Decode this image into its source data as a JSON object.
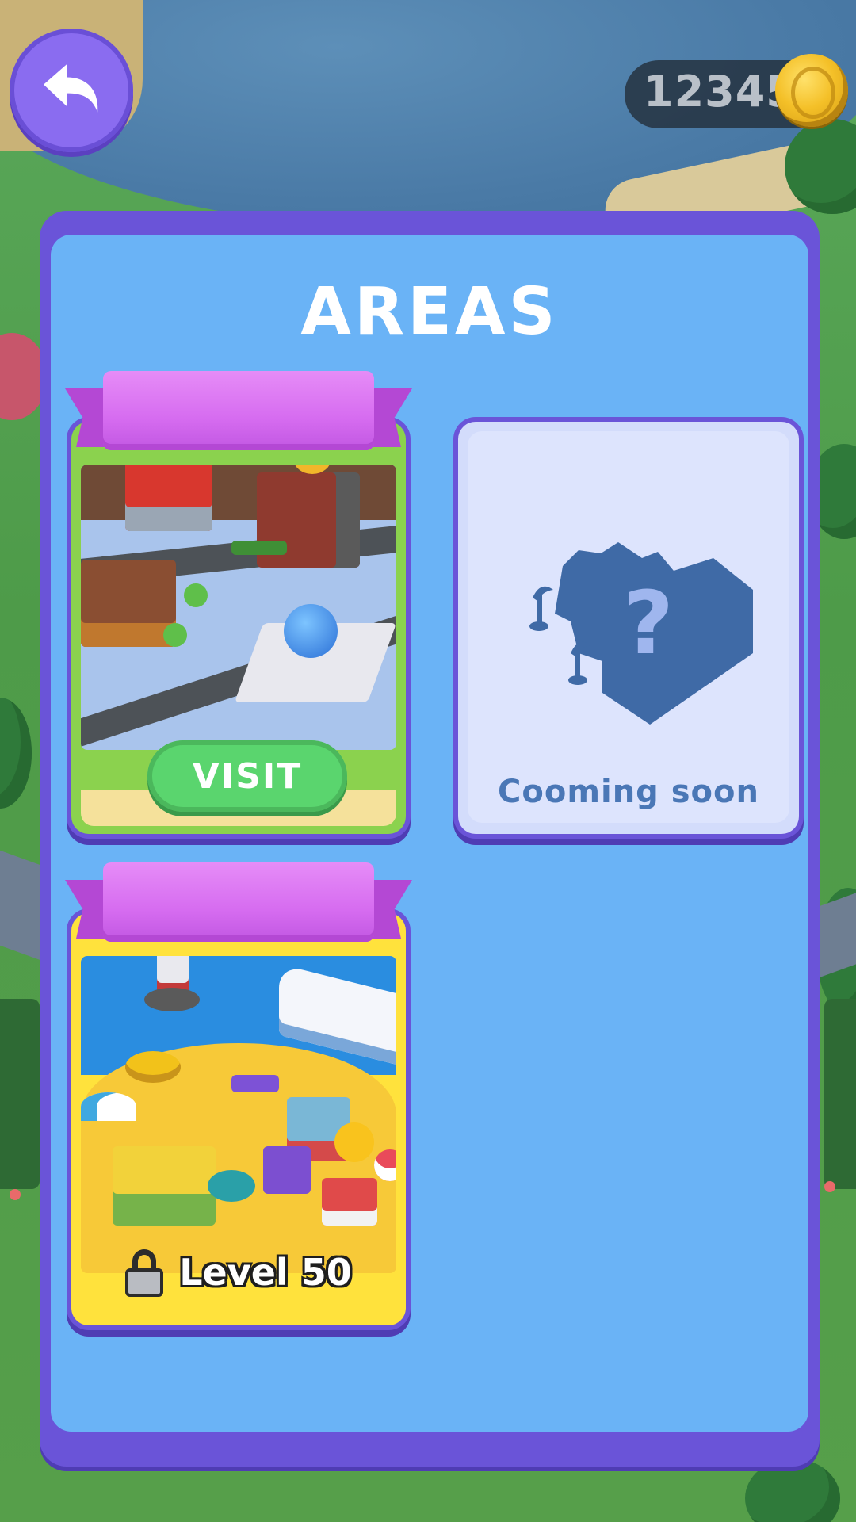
{
  "header": {
    "back_icon": "back-arrow-icon",
    "coins": "12345",
    "coin_icon": "gold-coin-icon"
  },
  "panel": {
    "title": "AREAS"
  },
  "areas": [
    {
      "id": "city",
      "status": "unlocked",
      "action_label": "VISIT"
    },
    {
      "id": "mystery",
      "status": "coming-soon",
      "label": "Cooming soon"
    },
    {
      "id": "beach",
      "status": "locked",
      "lock_icon": "lock-icon",
      "label": "Level 50"
    }
  ],
  "colors": {
    "panel_frame": "#6a54d8",
    "panel_fill": "#6ab3f6",
    "visit_button": "#5ad56e",
    "ribbon": "#d66cf0",
    "city_card": "#8bd24e",
    "beach_card": "#ffe23c",
    "coming_soon_text": "#4a77b6"
  }
}
